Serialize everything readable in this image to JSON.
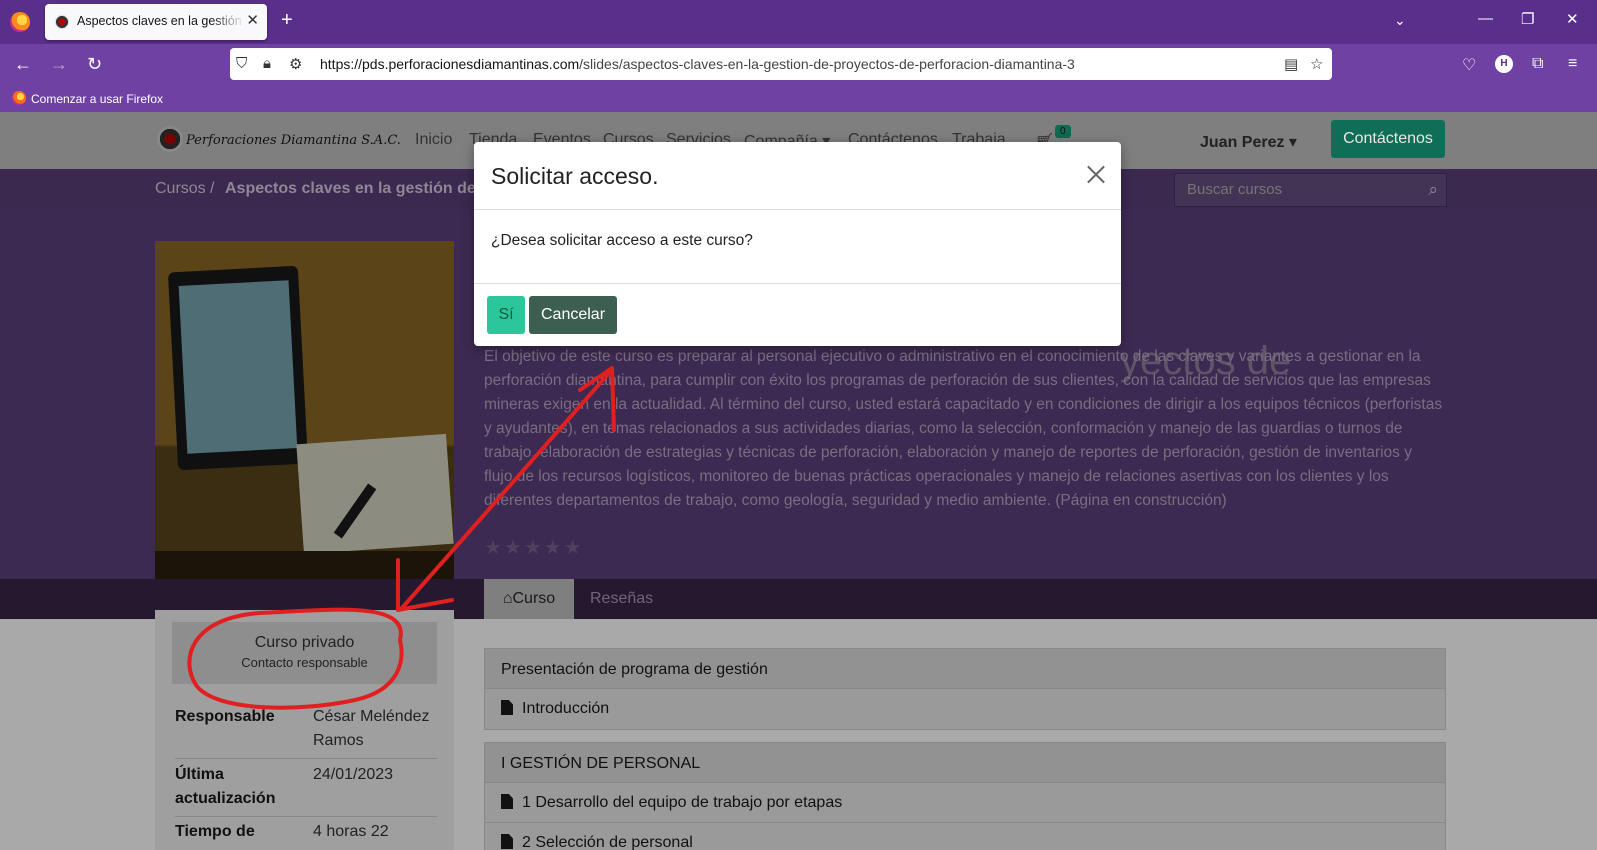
{
  "browser": {
    "tab_title": "Aspectos claves en la gestión de proyectos de perforación diamantina",
    "url_domain": "https://pds.perforacionesdiamantinas.com",
    "url_path": "/slides/aspectos-claves-en-la-gestion-de-proyectos-de-perforacion-diamantina-3",
    "bookmark": "Comenzar a usar Firefox",
    "profile_initial": "H"
  },
  "header": {
    "logo_text": "Perforaciones Diamantina S.A.C.",
    "menu": [
      "Inicio",
      "Tienda",
      "Eventos",
      "Cursos",
      "Servicios",
      "Compañía ▾",
      "Contáctenos",
      "Trabaja"
    ],
    "cart_count": "0",
    "user": "Juan Perez ▾",
    "contact_button": "Contáctenos"
  },
  "breadcrumb": {
    "root": "Cursos",
    "separator": "/",
    "current": "Aspectos claves en la gestión de p"
  },
  "search": {
    "placeholder": "Buscar cursos"
  },
  "course": {
    "title_fragment": "yectos de",
    "description": "El objetivo de este curso es preparar al personal ejecutivo o administrativo en el conocimiento de las claves y variantes a gestionar en la perforación diamantina, para cumplir con éxito los programas de perforación de sus clientes, con la calidad de servicios que las empresas mineras exigen en la actualidad. Al término del curso, usted estará capacitado y en condiciones de dirigir a los equipos técnicos (perforistas y ayudantes), en temas relacionados a sus actividades diarias, como la selección, conformación y manejo de las guardias o turnos de trabajo, elaboración de estrategias y técnicas de perforación, elaboración y manejo de reportes de perforación, gestión de inventarios y flujo de los recursos logísticos, monitoreo de buenas prácticas operacionales y manejo de relaciones asertivas con los clientes y los diferentes departamentos de trabajo, como geología, seguridad y medio ambiente. (Página en construcción)",
    "rating": 0,
    "tabs": [
      "Curso",
      "Reseñas"
    ]
  },
  "sidebar": {
    "private_title": "Curso privado",
    "private_subtitle": "Contacto responsable",
    "info": [
      {
        "label": "Responsable",
        "value": "César Meléndez Ramos"
      },
      {
        "label": "Última actualización",
        "value": "24/01/2023"
      },
      {
        "label": "Tiempo de",
        "value": "4 horas 22"
      }
    ]
  },
  "sections": [
    {
      "title": "Presentación de programa de gestión",
      "lessons": [
        "Introducción"
      ]
    },
    {
      "title": "I GESTIÓN DE PERSONAL",
      "lessons": [
        "1 Desarrollo del equipo de trabajo por etapas",
        "2 Selección de personal"
      ]
    }
  ],
  "modal": {
    "title": "Solicitar acceso.",
    "question": "¿Desea solicitar acceso a este curso?",
    "yes_label": "Sí",
    "cancel_label": "Cancelar"
  },
  "annotation_color": "#e02020"
}
